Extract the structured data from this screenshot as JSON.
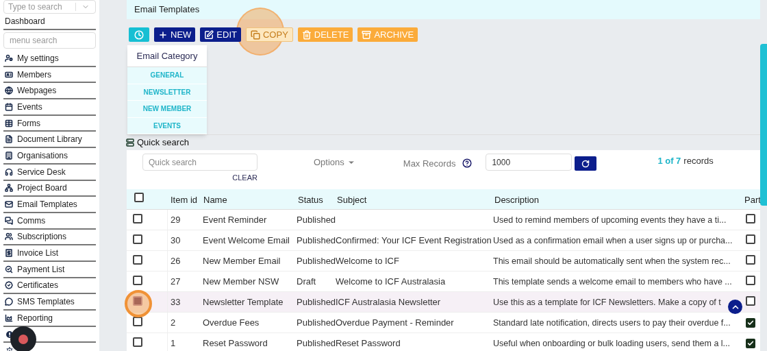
{
  "sidebar": {
    "search": {
      "placeholder": "Type to search"
    },
    "dashboard": "Dashboard",
    "menu_search": {
      "placeholder": "menu search"
    },
    "items": [
      {
        "label": "My settings"
      },
      {
        "label": "Members"
      },
      {
        "label": "Webpages"
      },
      {
        "label": "Events"
      },
      {
        "label": "Forms"
      },
      {
        "label": "Document Library"
      },
      {
        "label": "Organisations"
      },
      {
        "label": "Service Desk"
      },
      {
        "label": "Project Board"
      },
      {
        "label": "Email Templates"
      },
      {
        "label": "Comms"
      },
      {
        "label": "Subscriptions"
      },
      {
        "label": "Invoice List"
      },
      {
        "label": "Payment List"
      },
      {
        "label": "Certificates"
      },
      {
        "label": "SMS Templates"
      },
      {
        "label": "Reporting"
      },
      {
        "kind": "icon"
      },
      {
        "kind": "icon"
      }
    ]
  },
  "page_title": "Email Templates",
  "toolbar": [
    {
      "kind": "info"
    },
    {
      "kind": "primary",
      "label": "NEW"
    },
    {
      "kind": "primary",
      "label": "EDIT"
    },
    {
      "kind": "faded",
      "label": "COPY"
    },
    {
      "kind": "warning",
      "label": "DELETE"
    },
    {
      "kind": "warning",
      "label": "ARCHIVE"
    }
  ],
  "category_menu": {
    "title": "Email Category",
    "items": [
      "GENERAL",
      "NEWSLETTER",
      "NEW MEMBER",
      "EVENTS"
    ]
  },
  "quick_search": {
    "title": "Quick search",
    "placeholder": "Quick search",
    "clear": "CLEAR",
    "options": "Options",
    "max_records_label": "Max Records",
    "max_records": "1000",
    "count": "1 of 7",
    "count_suffix": "records"
  },
  "table": {
    "all_checked": false,
    "columns": [
      "Item id",
      "Name",
      "Status",
      "Subject",
      "Description",
      "Part"
    ],
    "rows": [
      {
        "selected": false,
        "id": "29",
        "name": "Event Reminder",
        "status": "Published",
        "subject": "",
        "description": "Used to remind members of upcoming events they have a ti...",
        "part": false
      },
      {
        "selected": false,
        "id": "30",
        "name": "Event Welcome Email",
        "status": "Published",
        "subject": "Confirmed: Your ICF Event Registration",
        "description": "Used as a confirmation email when a user signs up or purcha...",
        "part": false
      },
      {
        "selected": false,
        "id": "26",
        "name": "New Member Email",
        "status": "Published",
        "subject": "Welcome to ICF",
        "description": "This email should be automatically sent when the system rec...",
        "part": false
      },
      {
        "selected": false,
        "id": "27",
        "name": "New Member NSW",
        "status": "Draft",
        "subject": "Welcome to ICF Australasia",
        "description": "This template sends a welcome email to members who have ...",
        "part": false
      },
      {
        "selected": true,
        "id": "33",
        "name": "Newsletter Template",
        "status": "Published",
        "subject": "ICF Australasia Newsletter",
        "description": "Use this as a template for ICF Newsletters. Make a copy of t",
        "part": false
      },
      {
        "selected": false,
        "id": "2",
        "name": "Overdue Fees",
        "status": "Published",
        "subject": "Overdue Payment - Reminder",
        "description": "Standard late notification, directs users to pay their overdue f...",
        "part": true
      },
      {
        "selected": false,
        "id": "1",
        "name": "Reset Password",
        "status": "Published",
        "subject": "Reset Password",
        "description": "Useful when onboarding or bulk loading users, send them a l...",
        "part": true
      }
    ]
  }
}
